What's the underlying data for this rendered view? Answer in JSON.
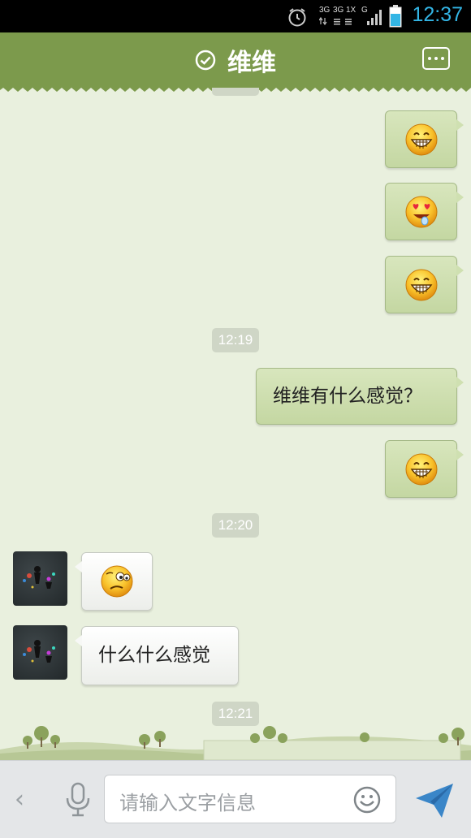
{
  "status_bar": {
    "time": "12:37",
    "network_labels": [
      "3G",
      "3G",
      "1X",
      "G"
    ],
    "icons": [
      "alarm-icon",
      "signal-icon",
      "battery-icon"
    ]
  },
  "header": {
    "title": "维维",
    "status_icon": "check-circle-icon",
    "menu_icon": "more-icon"
  },
  "messages": {
    "timestamps": [
      "12:19",
      "12:20",
      "12:21"
    ],
    "outgoing_text": "维维有什么感觉？",
    "incoming_text": "什么什么感觉",
    "emojis": [
      "grin-emoji",
      "heart-eyes-emoji",
      "grin-emoji",
      "grin-emoji",
      "confused-emoji"
    ]
  },
  "input_bar": {
    "placeholder": "请输入文字信息",
    "icons": [
      "back-chevron-icon",
      "microphone-icon",
      "smiley-icon",
      "send-icon"
    ]
  },
  "colors": {
    "header_green": "#7c9a4c",
    "chat_background": "#e9f0de",
    "outgoing_bubble": "#cfe0b1",
    "incoming_bubble": "#ffffff",
    "clock_blue": "#33b5e5"
  }
}
